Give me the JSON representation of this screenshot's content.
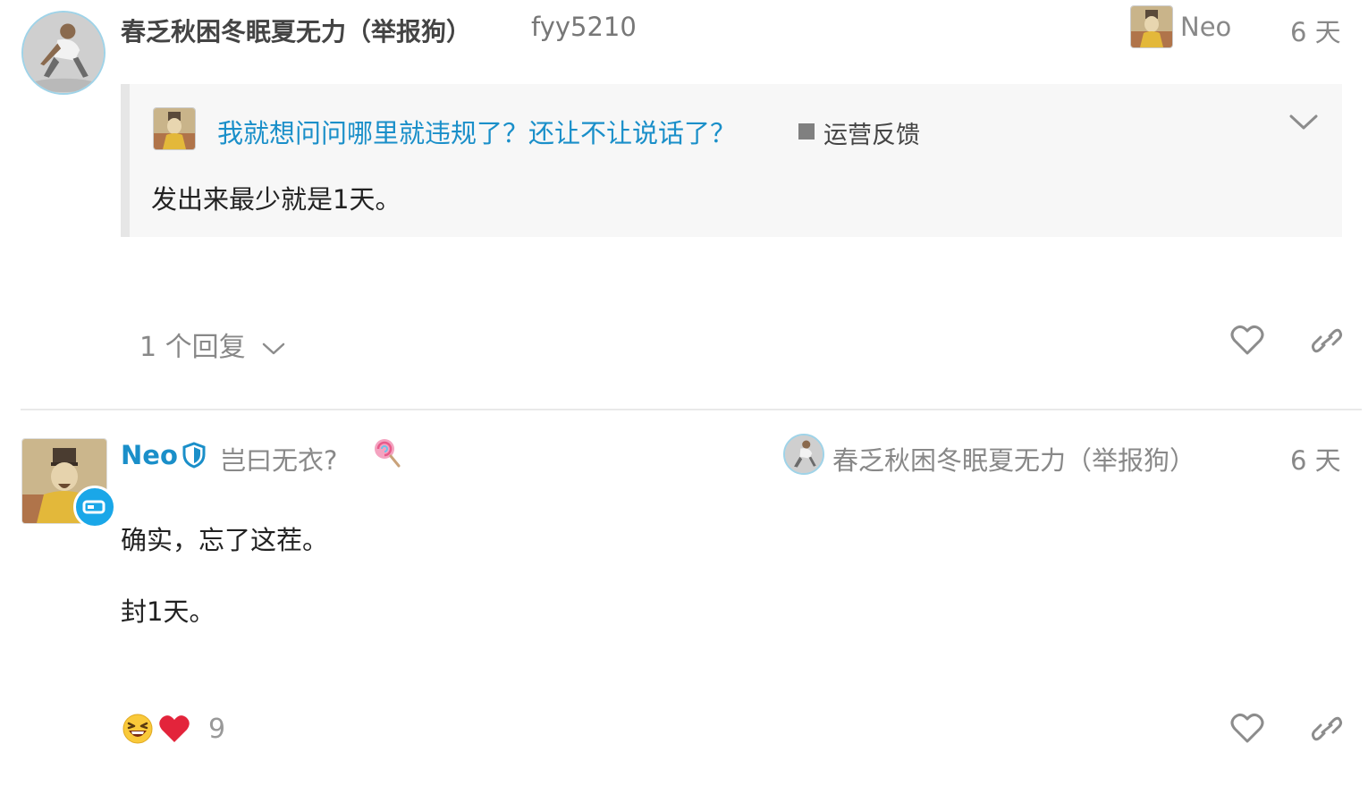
{
  "post1": {
    "username": "春乏秋困冬眠夏无力（举报狗）",
    "handle": "fyy5210",
    "reply_to": {
      "name": "Neo",
      "avatar": "emperor-avatar"
    },
    "time": "6 天",
    "quote": {
      "title": "我就想问问哪里就违规了？还让不让说话了？",
      "category": "运营反馈",
      "category_color": "#808080",
      "body": "发出来最少就是1天。"
    },
    "replies_label": "1 个回复"
  },
  "post2": {
    "username": "Neo",
    "title": "岂曰无衣?",
    "reply_to": {
      "name": "春乏秋困冬眠夏无力（举报狗）",
      "avatar": "kneeling-figure-avatar"
    },
    "time": "6 天",
    "paragraphs": [
      "确实，忘了这茬。",
      "封1天。"
    ],
    "reaction_count": "9",
    "accent_color": "#1a8fc9"
  }
}
